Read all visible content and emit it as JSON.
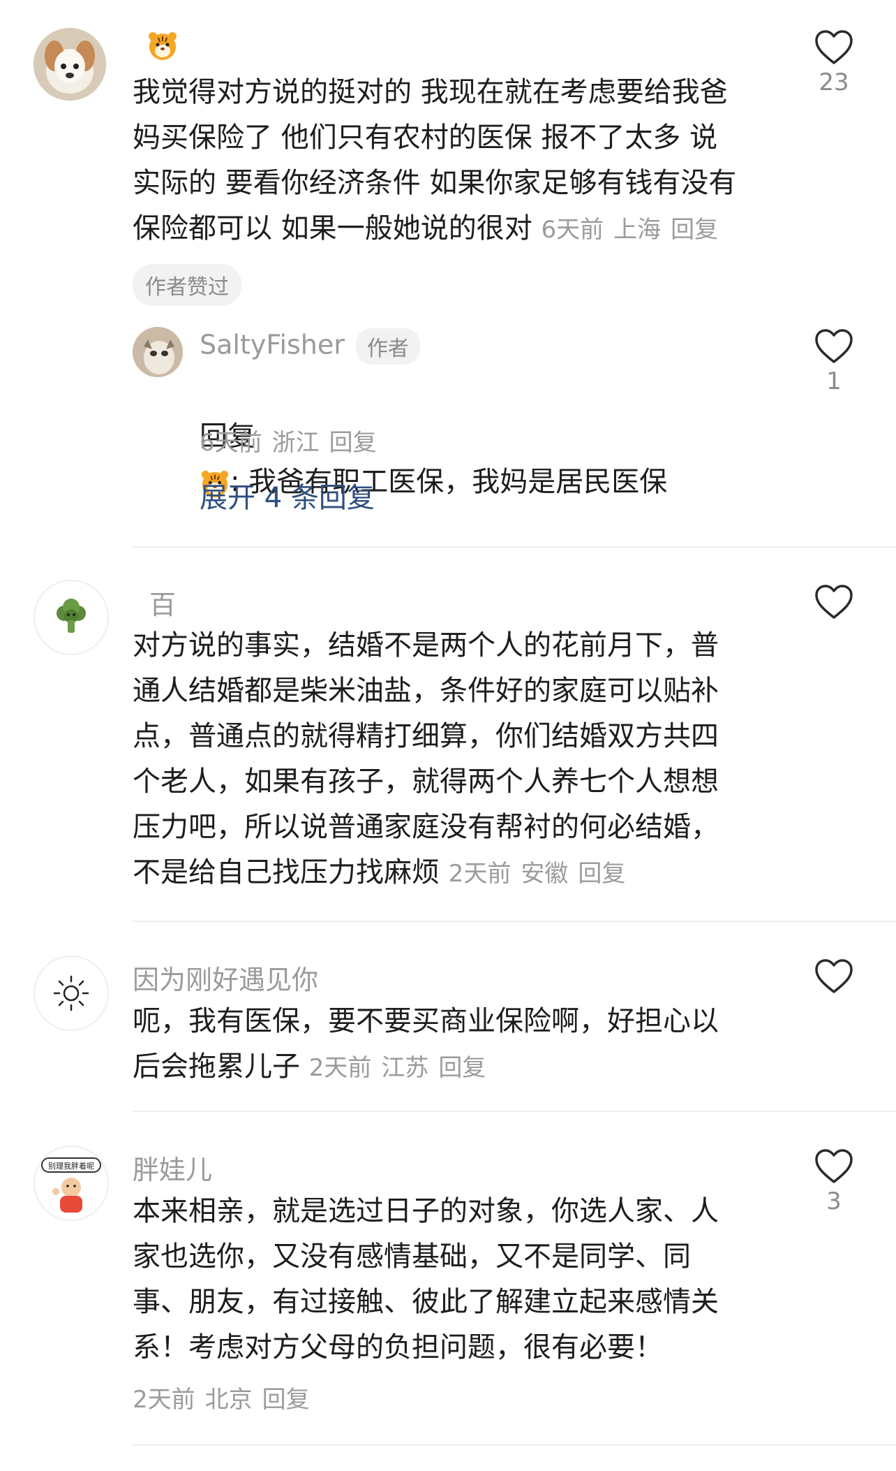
{
  "comments": [
    {
      "username_emoji": "tiger-emoji",
      "text": "我觉得对方说的挺对的 我现在就在考虑要给我爸\n妈买保险了 他们只有农村的医保 报不了太多  说\n实际的 要看你经济条件 如果你家足够有钱有没有\n保险都可以 如果一般她说的很对",
      "time": "6天前",
      "location": "上海",
      "reply": "回复",
      "likes": "23",
      "badge": "作者赞过",
      "sub_reply": {
        "username": "SaltyFisher",
        "tag": "作者",
        "prefix": "回复",
        "text": ": 我爸有职工医保，我妈是居民医保",
        "time": "6天前",
        "location": "浙江",
        "reply": "回复",
        "likes": "1"
      },
      "expand": "展开 4 条回复"
    },
    {
      "username": "百",
      "text": "对方说的事实，结婚不是两个人的花前月下，普\n通人结婚都是柴米油盐，条件好的家庭可以贴补\n点，普通点的就得精打细算，你们结婚双方共四\n个老人，如果有孩子，就得两个人养七个人想想\n压力吧，所以说普通家庭没有帮衬的何必结婚，\n不是给自己找压力找麻烦",
      "time": "2天前",
      "location": "安徽",
      "reply": "回复",
      "likes": ""
    },
    {
      "username": "因为刚好遇见你",
      "text": "呃，我有医保，要不要买商业保险啊，好担心以\n后会拖累儿子",
      "time": "2天前",
      "location": "江苏",
      "reply": "回复",
      "likes": ""
    },
    {
      "username": "胖娃儿",
      "avatar_text": "别理我胖着呢",
      "text": "本来相亲，就是选过日子的对象，你选人家、人\n家也选你，又没有感情基础，又不是同学、同\n事、朋友，有过接触、彼此了解建立起来感情关\n系！考虑对方父母的负担问题，很有必要！",
      "time": "2天前",
      "location": "北京",
      "reply": "回复",
      "likes": "3"
    }
  ],
  "colors": {
    "text": "#1d1d1d",
    "meta": "#9b9b9b",
    "link": "#2f4f7f",
    "divider": "#eeeeee"
  }
}
